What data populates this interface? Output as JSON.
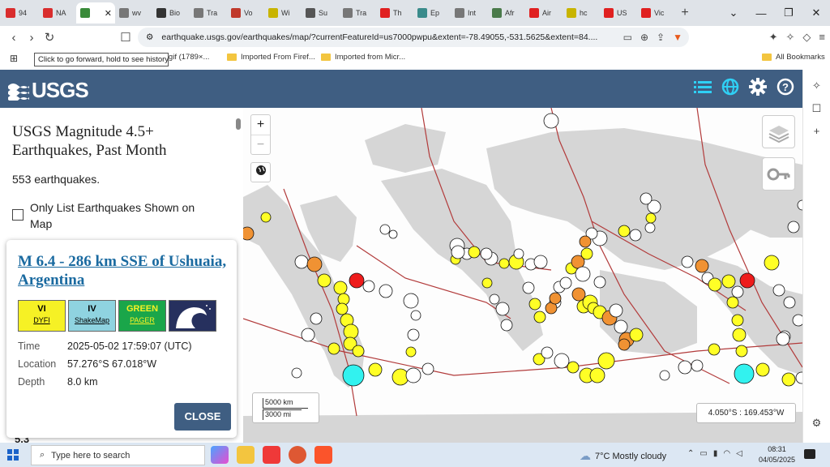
{
  "browser": {
    "tabs": [
      {
        "label": "94",
        "color": "#d92d2d"
      },
      {
        "label": "NA",
        "color": "#d92d2d"
      },
      {
        "label": "",
        "color": "#3a8b3a"
      },
      {
        "label": "wv",
        "color": "#777777"
      },
      {
        "label": "Bio",
        "color": "#333333"
      },
      {
        "label": "Tra",
        "color": "#777777"
      },
      {
        "label": "Vo",
        "color": "#c0392b"
      },
      {
        "label": "Wi",
        "color": "#c8b400"
      },
      {
        "label": "Su",
        "color": "#555555"
      },
      {
        "label": "Tra",
        "color": "#777777"
      },
      {
        "label": "Th",
        "color": "#e02020"
      },
      {
        "label": "Ep",
        "color": "#3a8b8b"
      },
      {
        "label": "Int",
        "color": "#777777"
      },
      {
        "label": "Afr",
        "color": "#4a7a4a"
      },
      {
        "label": "Air",
        "color": "#e02020"
      },
      {
        "label": "hc",
        "color": "#c8b400"
      },
      {
        "label": "US",
        "color": "#e02020"
      },
      {
        "label": "Vic",
        "color": "#e02020"
      }
    ],
    "url": "earthquake.usgs.gov/earthquakes/map/?currentFeatureId=us7000pwpu&extent=-78.49055,-531.5625&extent=84....",
    "tooltip": "Click to go forward, hold to see history",
    "bookmarks": {
      "gif": "0.gif (1789×...",
      "firefox": "Imported From Firef...",
      "microsoft": "Imported from Micr...",
      "all": "All Bookmarks"
    }
  },
  "usgs": {
    "logo": "USGS",
    "panel_title": "USGS Magnitude 4.5+ Earthquakes, Past Month",
    "count": "553 earthquakes.",
    "only_list": "Only List Earthquakes Shown on Map",
    "peek_text": "5.3"
  },
  "popup": {
    "title": "M 6.4 - 286 km SSE of Ushuaia, Argentina",
    "badges": [
      {
        "top": "VI",
        "bottom": "DYFI",
        "bg": "#f6f125"
      },
      {
        "top": "IV",
        "bottom": "ShakeMap",
        "bg": "#8fd3e0"
      },
      {
        "top": "GREEN",
        "bottom": "PAGER",
        "bg": "#1aa64a"
      }
    ],
    "details": [
      {
        "key": "Time",
        "value": "2025-05-02 17:59:07 (UTC)"
      },
      {
        "key": "Location",
        "value": "57.276°S 67.018°W"
      },
      {
        "key": "Depth",
        "value": "8.0 km"
      }
    ],
    "close_label": "CLOSE"
  },
  "map": {
    "scale_km": "5000 km",
    "scale_mi": "3000 mi",
    "coords": "4.050°S : 169.453°W",
    "colors": {
      "white": "#ffffff",
      "yellow": "#ffff26",
      "orange": "#f09233",
      "red": "#ee1c1c",
      "cyan": "#32f2ef"
    }
  },
  "taskbar": {
    "search_placeholder": "Type here to search",
    "weather": "7°C  Mostly cloudy",
    "time": "08:31",
    "date": "04/05/2025"
  }
}
